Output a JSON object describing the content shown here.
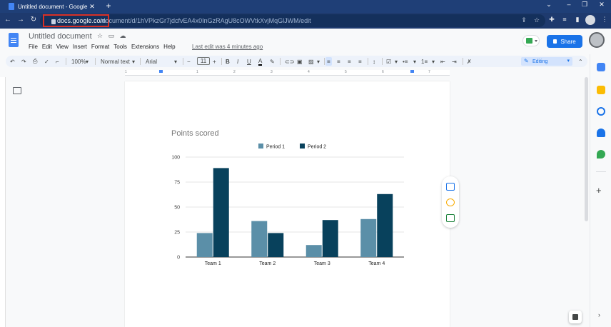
{
  "browser": {
    "tab_title": "Untitled document - Google Docs",
    "new_tab": "+",
    "url_host": "docs.google.com",
    "url_path": "/document/d/1hVPkzGr7jdcfvEA4x0InGzRAgU8cOWVtkXvjMqGlJWM/edit"
  },
  "docs": {
    "title": "Untitled document",
    "last_edit": "Last edit was 4 minutes ago",
    "share_label": "Share",
    "menu": [
      "File",
      "Edit",
      "View",
      "Insert",
      "Format",
      "Tools",
      "Extensions",
      "Help"
    ]
  },
  "toolbar": {
    "zoom": "100%",
    "style": "Normal text",
    "font": "Arial",
    "font_size": "11",
    "mode": "Editing"
  },
  "ruler": {
    "numbers": [
      "1",
      "1",
      "2",
      "3",
      "4",
      "5",
      "6",
      "7"
    ]
  },
  "chart_data": {
    "type": "bar",
    "title": "Points scored",
    "categories": [
      "Team 1",
      "Team 2",
      "Team 3",
      "Team 4"
    ],
    "series": [
      {
        "name": "Period 1",
        "values": [
          24,
          36,
          12,
          38
        ],
        "color": "#5b8fa8"
      },
      {
        "name": "Period 2",
        "values": [
          89,
          24,
          37,
          63
        ],
        "color": "#08415c"
      }
    ],
    "ylim": [
      0,
      100
    ],
    "yticks": [
      0,
      25,
      50,
      75,
      100
    ],
    "legend": "top-center",
    "grid": true
  }
}
